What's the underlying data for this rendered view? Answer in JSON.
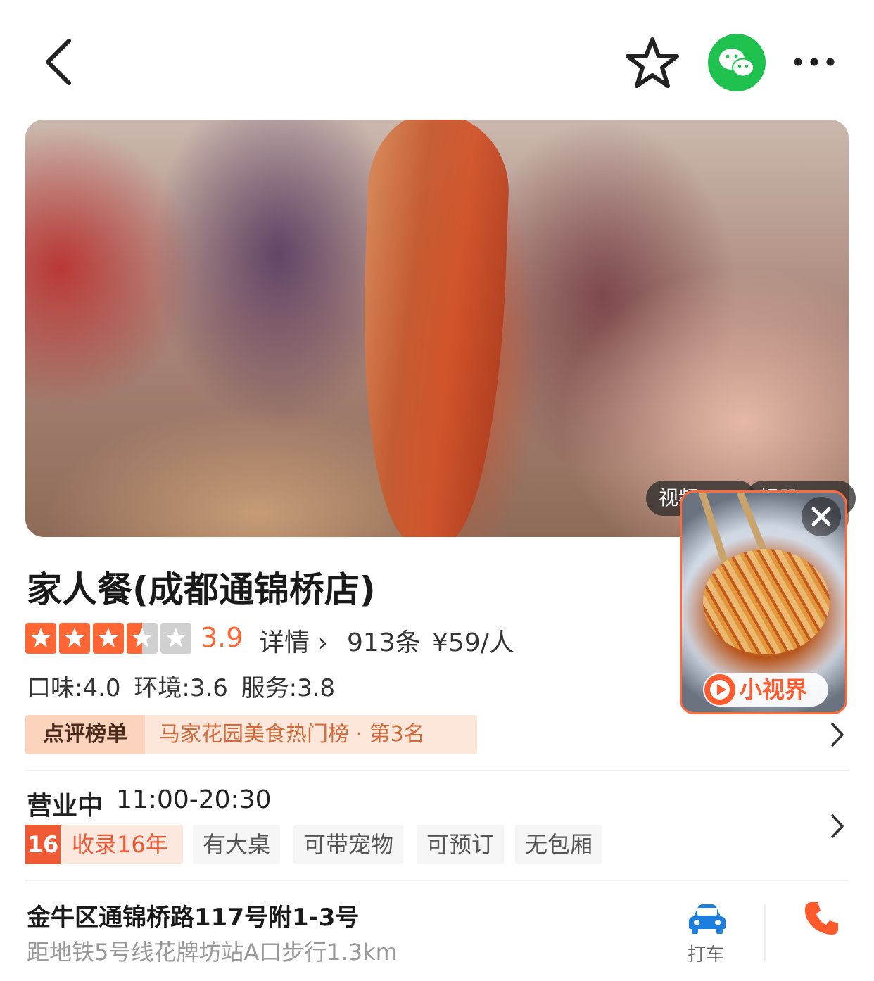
{
  "nav": {
    "back_icon": "chevron-left-icon",
    "favorite_icon": "star-outline-icon",
    "share_icon": "wechat-icon",
    "more_icon": "more-horizontal-icon",
    "wechat_color": "#1fc24f"
  },
  "hero": {
    "video_tab": "视频 ›",
    "album_tab": "相册 ›"
  },
  "mini_video": {
    "badge": "小视界",
    "close_icon": "close-icon",
    "accent": "#ff5b2e"
  },
  "shop": {
    "name": "家人餐(成都通锦桥店)",
    "stars": 3.5,
    "rating": "3.9",
    "detail_link": "详情 ›",
    "review_count": "913条",
    "price": "¥59/人",
    "subscores": "口味:4.0  环境:3.6  服务:3.8",
    "accent": "#ff6633"
  },
  "rank": {
    "tag": "点评榜单",
    "text": "马家花园美食热门榜 · 第3名"
  },
  "hours": {
    "status": "营业中",
    "time": "11:00-20:30"
  },
  "tags": {
    "record_num": "16",
    "record_label": "收录16年",
    "items": [
      "有大桌",
      "可带宠物",
      "可预订",
      "无包厢"
    ]
  },
  "location": {
    "address": "金牛区通锦桥路117号附1-3号",
    "metro": "距地铁5号线花牌坊站A口步行1.3km",
    "taxi_label": "打车",
    "car_icon": "car-icon",
    "phone_icon": "phone-icon"
  }
}
